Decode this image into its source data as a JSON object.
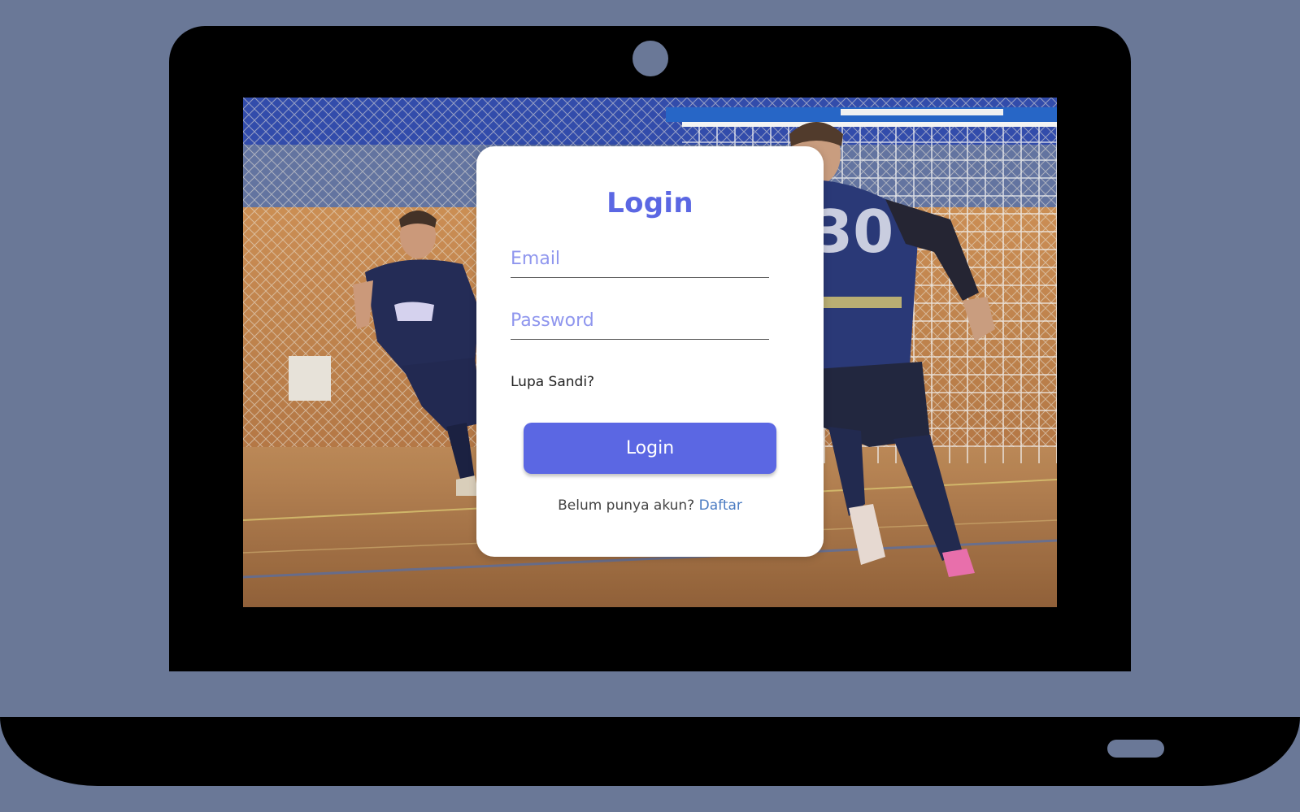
{
  "login": {
    "title": "Login",
    "email_placeholder": "Email",
    "password_placeholder": "Password",
    "forgot_label": "Lupa Sandi?",
    "button_label": "Login",
    "signup_prompt": "Belum punya akun?",
    "signup_link": "Daftar"
  },
  "colors": {
    "page_background": "#6a7897",
    "accent": "#5b67e3",
    "placeholder": "#8f96ee",
    "link": "#4a7bc2"
  },
  "background_image": "futsal-match-photo"
}
